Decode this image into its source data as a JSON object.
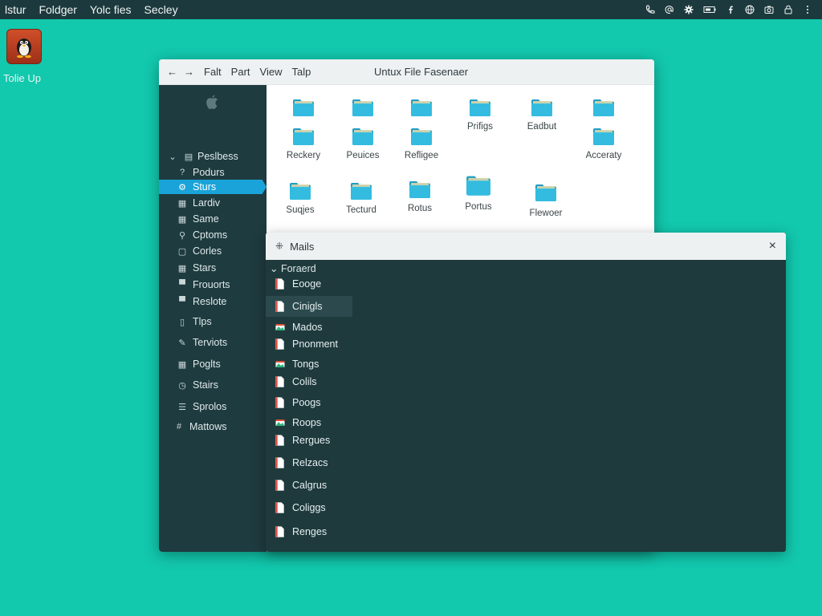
{
  "topbar": {
    "menu": [
      "lstur",
      "Foldger",
      "Yolc fies",
      "Secley"
    ],
    "tray_icons": [
      "phone-icon",
      "at-icon",
      "gear-icon",
      "battery-icon",
      "facebook-icon",
      "globe-icon",
      "camera-icon",
      "lock-icon",
      "menu-icon"
    ]
  },
  "desktop": {
    "icon_label": "Tolie Up",
    "icon_name": "penguin-icon"
  },
  "file_manager": {
    "title": "Untux File Fasenaer",
    "nav": [
      "←",
      "→"
    ],
    "menu": [
      "Falt",
      "Part",
      "View",
      "Talp"
    ],
    "sidebar": {
      "logo": "apple-icon",
      "items": [
        {
          "label": "Peslbess",
          "icon": "chevron-down-icon"
        },
        {
          "label": "Podurs",
          "icon": "question-icon"
        },
        {
          "label": "Sturs",
          "icon": "gear-icon"
        },
        {
          "label": "Lardiv",
          "icon": "grid-icon"
        },
        {
          "label": "Same",
          "icon": "grid-icon"
        },
        {
          "label": "Cptoms",
          "icon": "search-icon"
        },
        {
          "label": "Corles",
          "icon": "box-icon"
        },
        {
          "label": "Stars",
          "icon": "grid-icon"
        },
        {
          "label": "Frouorts",
          "icon": "monitor-icon"
        },
        {
          "label": "Reslote",
          "icon": "monitor-icon"
        },
        {
          "label": "Tlps",
          "icon": "file-icon"
        },
        {
          "label": "Terviots",
          "icon": "pen-icon"
        },
        {
          "label": "Poglts",
          "icon": "grid-icon"
        },
        {
          "label": "Stairs",
          "icon": "clock-icon"
        },
        {
          "label": "Sprolos",
          "icon": "list-icon"
        },
        {
          "label": "Mattows",
          "icon": "hash-icon"
        }
      ]
    },
    "folders": [
      {
        "label": ""
      },
      {
        "label": ""
      },
      {
        "label": ""
      },
      {
        "label": "Prifigs"
      },
      {
        "label": "Eadbut"
      },
      {
        "label": ""
      },
      {
        "label": "Reckery"
      },
      {
        "label": "Peuices"
      },
      {
        "label": "Refligee"
      },
      {
        "label": "Acceraty"
      },
      {
        "label": "Suqjes"
      },
      {
        "label": "Tecturd"
      },
      {
        "label": "Rotus"
      },
      {
        "label": "Portus"
      },
      {
        "label": "Flewoer"
      }
    ]
  },
  "mails": {
    "title": "Mails",
    "header_icon": "hash-icon",
    "close": "×",
    "group": "⌄ Foraerd",
    "items": [
      {
        "label": "Eooge"
      },
      {
        "label": "Cinigls"
      },
      {
        "label": "Mados"
      },
      {
        "label": "Pnonment"
      },
      {
        "label": "Tongs"
      },
      {
        "label": "Colils"
      },
      {
        "label": "Poogs"
      },
      {
        "label": "Roops"
      },
      {
        "label": "Rergues"
      },
      {
        "label": "Relzacs"
      },
      {
        "label": "Calgrus"
      },
      {
        "label": "Coliggs"
      },
      {
        "label": "Renges"
      }
    ]
  },
  "colors": {
    "desktop": "#12c8ad",
    "sidebar": "#1e3b3f",
    "accent": "#1aa3d8",
    "folder": "#2fb5d8"
  }
}
